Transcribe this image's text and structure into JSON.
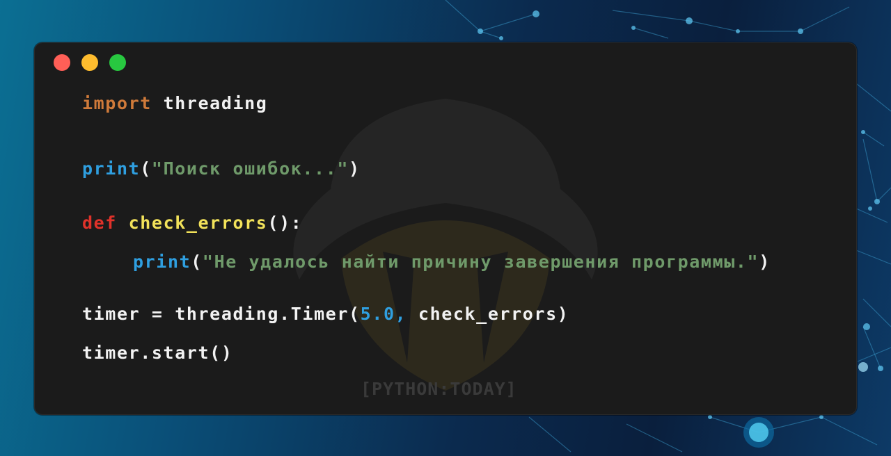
{
  "window": {
    "controls": {
      "close": "#ff5f57",
      "minimize": "#febc2e",
      "maximize": "#28c840"
    }
  },
  "watermark": {
    "text": "[PYTHON:TODAY]"
  },
  "code": {
    "line1": {
      "kw": "import",
      "rest": " threading"
    },
    "line2": {
      "fn": "print",
      "open": "(",
      "str": "\"Поиск ошибок...\"",
      "close": ")"
    },
    "line3": {
      "kw": "def",
      "sp": " ",
      "name": "check_errors",
      "rest": "():"
    },
    "line4": {
      "indent": "   ",
      "fn": "print",
      "open": "(",
      "str": "\"Не удалось найти причину завершения программы.\"",
      "close": ")"
    },
    "line5": {
      "pre": "timer = threading.Timer(",
      "num": "5.0",
      "comma": ",",
      "post": " check_errors)"
    },
    "line6": {
      "text": "timer.start()"
    }
  },
  "colors": {
    "keyword_import": "#cf7a3a",
    "keyword_def": "#e0322a",
    "function_name": "#f2e25a",
    "builtin": "#2f9fe0",
    "string": "#6f9a6a",
    "number": "#2f9fe0",
    "text": "#f2f2f2",
    "editor_bg": "#1b1b1b"
  }
}
